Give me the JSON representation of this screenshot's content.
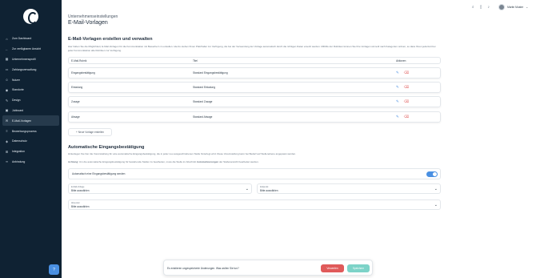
{
  "sidebar": {
    "items": [
      {
        "label": "Zum Dashboard",
        "icon": "home-icon"
      },
      {
        "label": "Zur verfügbaren Ansicht",
        "icon": "arrow-left-icon"
      },
      {
        "label": "Unternehmensprofil",
        "icon": "building-icon"
      },
      {
        "label": "Zahlungsverwaltung",
        "icon": "credit-card-icon"
      },
      {
        "label": "Nutzer",
        "icon": "users-icon"
      },
      {
        "label": "Standorte",
        "icon": "pin-icon"
      },
      {
        "label": "Design",
        "icon": "brush-icon"
      },
      {
        "label": "Jobboard",
        "icon": "briefcase-icon"
      },
      {
        "label": "E-Mail-Vorlagen",
        "icon": "mail-icon"
      },
      {
        "label": "Bewerbungsprozess",
        "icon": "flow-icon"
      },
      {
        "label": "Datenschutz",
        "icon": "shield-icon"
      },
      {
        "label": "Integration",
        "icon": "plug-icon"
      },
      {
        "label": "Anbindung",
        "icon": "link-icon"
      }
    ]
  },
  "header": {
    "user_name": "Martin Muster"
  },
  "main": {
    "breadcrumb": "Unternehmenseinstellungen",
    "title": "E-Mail-Vorlagen",
    "section1": {
      "title": "E-Mail-Vorlagen erstellen und verwalten",
      "description": "Hier haben Sie die Möglichkeit, E-Mail-Vorlagen für die Kommunikation mit Bewerbern zu erstellen. Hierzu stehen Ihnen Platzhalter zur Verfügung, die bei der Verwendung der Vorlage automatisch durch die richtigen Daten ersetzt werden. Mithilfe der Rubriken können Sie Ihre Vorlagen sinnvoll nach Kategorien ordnen, so dass Ihnen jederzeit bei jeder Kommunikation alle Rubriken zur Verfügung.",
      "columns": [
        "E-Mail-Rubrik",
        "Titel",
        "Aktionen"
      ],
      "rows": [
        {
          "rubric": "Eingangsbestätigung",
          "title": "Standard Eingangsbestätigung"
        },
        {
          "rubric": "Einladung",
          "title": "Standard Einladung"
        },
        {
          "rubric": "Zusage",
          "title": "Standard Zusage"
        },
        {
          "rubric": "Absage",
          "title": "Standard Absage"
        }
      ],
      "new_button": "+ Neue Vorlage erstellen"
    },
    "section2": {
      "title": "Automatische Eingangsbestätigung",
      "description1": "Hinterlegen Sie hier die Voreinstellung für eine automatische Eingangsbestätigung, die in jeder neu ausgeschriebenen Stelle hinterlegt wird. Diese Voreinstellung kann bei Bedarf auf Stellenebene angepasst werden.",
      "description2_bold": "Achtung:",
      "description2": "Um die automatische Eingangsbestätigung für bestehende Stellen zu bearbeiten, muss die Stelle im Abschnitt",
      "description2_bold2": "Automatisierungen",
      "description2_end": "der Stellenansicht bearbeitet werden.",
      "toggle_label": "Automatisch eine Eingangsbestätigung senden",
      "toggle_on": true,
      "select_template": {
        "label": "E-Mail-Vorlage",
        "value": "Bitte auswählen"
      },
      "select_delay": {
        "label": "Zeitpunkt",
        "value": "Bitte auswählen"
      },
      "select_sender": {
        "label": "Absender",
        "value": "Bitte auswählen"
      }
    }
  },
  "save_bar": {
    "message": "Es existieren ungespeicherte Änderungen. Was wollen Sie tun?",
    "discard_label": "Verwerfen",
    "save_label": "Speichern"
  },
  "colors": {
    "sidebar_bg": "#0f2233",
    "accent": "#4a90e2",
    "danger": "#e05a5a",
    "save": "#7dd3c8"
  }
}
